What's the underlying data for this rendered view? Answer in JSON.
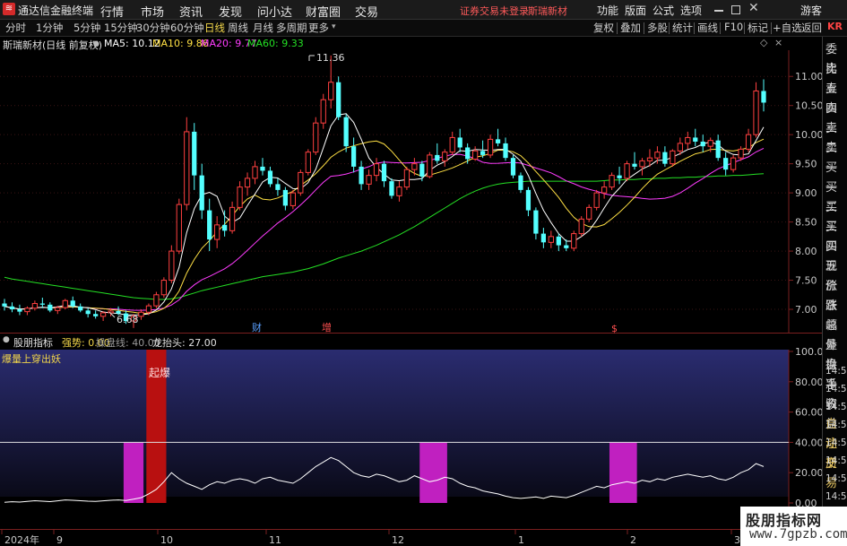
{
  "app": {
    "name": "通达信金融终端",
    "menus": [
      "行情",
      "市场",
      "资讯",
      "发现",
      "问小达",
      "财富圈",
      "交易"
    ],
    "warning": "证券交易未登录",
    "stock_name": "斯瑞新材",
    "right_menus": [
      "功能",
      "版面",
      "公式",
      "选项"
    ],
    "guest": "游客"
  },
  "toolbar": {
    "periods": [
      "分时",
      "1分钟",
      "5分钟",
      "15分钟",
      "30分钟",
      "60分钟",
      "日线",
      "周线",
      "月线",
      "多周期",
      "更多"
    ],
    "active_period": "日线",
    "right_buttons": [
      "复权",
      "叠加",
      "多股",
      "统计",
      "画线",
      "F10",
      "标记",
      "+自选",
      "返回"
    ],
    "kr": "KR"
  },
  "info": {
    "title": "斯瑞新材(日线 前复权)",
    "ma5": "MA5: 10.12",
    "ma10": "MA10: 9.86",
    "ma20": "MA20: 9.77",
    "ma60": "MA60: 9.33"
  },
  "right_panel": [
    "委比",
    "卖五",
    "卖四",
    "卖三",
    "卖二",
    "卖一",
    "买一",
    "买二",
    "买三",
    "买四",
    "买五",
    "现价",
    "涨跌",
    "涨幅",
    "总量",
    "外盘",
    "换手",
    "净资",
    "收益",
    "自动",
    "注册",
    "交易"
  ],
  "price_axis": [
    "11.00",
    "10.50",
    "10.00",
    "9.50",
    "9.00",
    "8.50",
    "8.00",
    "7.50",
    "7.00"
  ],
  "annotations": {
    "high": "11.36",
    "low": "6.68",
    "event1": "财",
    "event2": "增",
    "event3": "$"
  },
  "indicator": {
    "name": "股朋指标",
    "strength": "强势: 0.00",
    "control": "操盘线: 40.00",
    "dragon": "龙抬头: 27.00",
    "signal_text": "爆量上穿出妖",
    "explode_label": "起爆",
    "axis": [
      "100.0",
      "80.00",
      "60.00",
      "40.00",
      "20.00",
      "0.00"
    ],
    "time_axis": [
      "14:56",
      "14:56",
      "14:56",
      "14:56",
      "14:56",
      "14:56",
      "14:56",
      "14:56"
    ]
  },
  "date_axis": [
    "2024年",
    "9",
    "10",
    "11",
    "12",
    "1",
    "2",
    "3"
  ],
  "watermark": {
    "line1": "股朋指标网",
    "line2": "www.7gpzb.com"
  },
  "colors": {
    "up": "#ff4040",
    "down": "#54ffff",
    "ma5": "#ffffff",
    "ma10": "#ffe044",
    "ma20": "#ff3cff",
    "ma60": "#24e024",
    "accent": "#f2d64a"
  },
  "chart_data": {
    "type": "candlestick",
    "title": "斯瑞新材(日线 前复权)",
    "ylim": [
      6.6,
      11.45
    ],
    "candles": [
      [
        7.1,
        7.18,
        6.98,
        7.05
      ],
      [
        7.05,
        7.12,
        6.95,
        7.0
      ],
      [
        7.0,
        7.08,
        6.9,
        6.96
      ],
      [
        6.96,
        7.05,
        6.9,
        7.02
      ],
      [
        7.02,
        7.15,
        6.98,
        7.1
      ],
      [
        7.1,
        7.2,
        7.02,
        7.08
      ],
      [
        7.08,
        7.12,
        6.95,
        6.98
      ],
      [
        6.98,
        7.06,
        6.92,
        7.03
      ],
      [
        7.03,
        7.18,
        7.0,
        7.15
      ],
      [
        7.15,
        7.22,
        7.02,
        7.05
      ],
      [
        7.05,
        7.1,
        6.95,
        6.98
      ],
      [
        6.98,
        7.02,
        6.86,
        6.92
      ],
      [
        6.92,
        6.98,
        6.84,
        6.88
      ],
      [
        6.88,
        6.97,
        6.8,
        6.94
      ],
      [
        6.94,
        7.02,
        6.88,
        6.97
      ],
      [
        6.97,
        7.05,
        6.9,
        6.93
      ],
      [
        6.93,
        6.98,
        6.75,
        6.8
      ],
      [
        6.8,
        6.92,
        6.68,
        6.88
      ],
      [
        6.88,
        7.0,
        6.82,
        6.95
      ],
      [
        6.95,
        7.1,
        6.9,
        7.06
      ],
      [
        7.06,
        7.3,
        7.02,
        7.25
      ],
      [
        7.25,
        7.55,
        7.2,
        7.5
      ],
      [
        7.5,
        8.1,
        7.45,
        8.0
      ],
      [
        8.0,
        8.9,
        7.95,
        8.8
      ],
      [
        8.8,
        10.3,
        8.7,
        10.05
      ],
      [
        10.05,
        10.2,
        9.05,
        9.3
      ],
      [
        9.3,
        9.5,
        8.55,
        8.7
      ],
      [
        8.7,
        8.9,
        8.0,
        8.2
      ],
      [
        8.2,
        8.6,
        8.05,
        8.45
      ],
      [
        8.45,
        8.7,
        8.25,
        8.35
      ],
      [
        8.35,
        8.85,
        8.3,
        8.75
      ],
      [
        8.75,
        9.2,
        8.7,
        9.1
      ],
      [
        9.1,
        9.35,
        8.95,
        9.25
      ],
      [
        9.25,
        9.55,
        9.15,
        9.45
      ],
      [
        9.45,
        9.6,
        9.3,
        9.38
      ],
      [
        9.38,
        9.45,
        9.1,
        9.15
      ],
      [
        9.15,
        9.25,
        8.95,
        9.05
      ],
      [
        9.05,
        9.1,
        8.7,
        8.78
      ],
      [
        8.78,
        9.05,
        8.72,
        9.0
      ],
      [
        9.0,
        9.4,
        8.95,
        9.35
      ],
      [
        9.35,
        9.75,
        9.3,
        9.7
      ],
      [
        9.7,
        10.3,
        9.65,
        10.2
      ],
      [
        10.2,
        10.7,
        10.1,
        10.6
      ],
      [
        10.6,
        11.36,
        10.45,
        10.9
      ],
      [
        10.9,
        11.0,
        10.25,
        10.3
      ],
      [
        10.3,
        10.35,
        9.7,
        9.8
      ],
      [
        9.8,
        9.95,
        9.35,
        9.45
      ],
      [
        9.45,
        9.55,
        9.05,
        9.15
      ],
      [
        9.15,
        9.4,
        9.05,
        9.3
      ],
      [
        9.3,
        9.6,
        9.2,
        9.5
      ],
      [
        9.5,
        9.55,
        9.1,
        9.2
      ],
      [
        9.2,
        9.25,
        8.9,
        8.95
      ],
      [
        8.95,
        9.2,
        8.85,
        9.1
      ],
      [
        9.1,
        9.45,
        9.05,
        9.4
      ],
      [
        9.4,
        9.6,
        9.3,
        9.5
      ],
      [
        9.5,
        9.55,
        9.2,
        9.28
      ],
      [
        9.28,
        9.7,
        9.25,
        9.65
      ],
      [
        9.65,
        9.85,
        9.5,
        9.55
      ],
      [
        9.55,
        9.75,
        9.45,
        9.7
      ],
      [
        9.7,
        10.05,
        9.65,
        9.95
      ],
      [
        9.95,
        10.1,
        9.7,
        9.78
      ],
      [
        9.78,
        9.85,
        9.5,
        9.58
      ],
      [
        9.58,
        9.8,
        9.55,
        9.72
      ],
      [
        9.72,
        9.9,
        9.6,
        9.65
      ],
      [
        9.65,
        10.0,
        9.6,
        9.92
      ],
      [
        9.92,
        10.1,
        9.8,
        9.85
      ],
      [
        9.85,
        9.95,
        9.55,
        9.6
      ],
      [
        9.6,
        9.65,
        9.25,
        9.3
      ],
      [
        9.3,
        9.35,
        9.0,
        9.05
      ],
      [
        9.05,
        9.1,
        8.6,
        8.7
      ],
      [
        8.7,
        8.75,
        8.2,
        8.3
      ],
      [
        8.3,
        8.4,
        8.05,
        8.15
      ],
      [
        8.15,
        8.35,
        8.05,
        8.25
      ],
      [
        8.25,
        8.3,
        8.0,
        8.1
      ],
      [
        8.1,
        8.2,
        8.0,
        8.05
      ],
      [
        8.05,
        8.35,
        8.0,
        8.3
      ],
      [
        8.3,
        8.6,
        8.25,
        8.55
      ],
      [
        8.55,
        8.8,
        8.5,
        8.75
      ],
      [
        8.75,
        9.05,
        8.7,
        9.0
      ],
      [
        9.0,
        9.2,
        8.9,
        9.1
      ],
      [
        9.1,
        9.35,
        9.05,
        9.3
      ],
      [
        9.3,
        9.45,
        9.15,
        9.25
      ],
      [
        9.25,
        9.55,
        9.2,
        9.5
      ],
      [
        9.5,
        9.7,
        9.4,
        9.45
      ],
      [
        9.45,
        9.6,
        9.3,
        9.55
      ],
      [
        9.55,
        9.75,
        9.45,
        9.6
      ],
      [
        9.6,
        9.8,
        9.5,
        9.7
      ],
      [
        9.7,
        9.8,
        9.45,
        9.5
      ],
      [
        9.5,
        9.75,
        9.45,
        9.72
      ],
      [
        9.72,
        9.95,
        9.65,
        9.85
      ],
      [
        9.85,
        10.05,
        9.75,
        9.95
      ],
      [
        9.95,
        10.1,
        9.8,
        9.88
      ],
      [
        9.88,
        10.0,
        9.7,
        9.8
      ],
      [
        9.8,
        9.95,
        9.7,
        9.9
      ],
      [
        9.9,
        10.0,
        9.55,
        9.6
      ],
      [
        9.6,
        9.7,
        9.3,
        9.4
      ],
      [
        9.4,
        9.65,
        9.35,
        9.6
      ],
      [
        9.6,
        9.8,
        9.55,
        9.75
      ],
      [
        9.75,
        10.1,
        9.7,
        10.0
      ],
      [
        10.0,
        10.9,
        9.95,
        10.75
      ],
      [
        10.75,
        10.95,
        10.4,
        10.55
      ]
    ],
    "ma60": [
      7.55,
      7.52,
      7.5,
      7.48,
      7.46,
      7.44,
      7.42,
      7.4,
      7.38,
      7.36,
      7.34,
      7.32,
      7.3,
      7.28,
      7.26,
      7.24,
      7.22,
      7.2,
      7.19,
      7.18,
      7.17,
      7.17,
      7.18,
      7.2,
      7.24,
      7.28,
      7.32,
      7.35,
      7.38,
      7.41,
      7.44,
      7.47,
      7.5,
      7.53,
      7.56,
      7.58,
      7.6,
      7.62,
      7.64,
      7.67,
      7.7,
      7.74,
      7.78,
      7.83,
      7.88,
      7.92,
      7.96,
      8.0,
      8.05,
      8.1,
      8.16,
      8.22,
      8.28,
      8.35,
      8.42,
      8.5,
      8.58,
      8.66,
      8.74,
      8.82,
      8.9,
      8.97,
      9.03,
      9.08,
      9.12,
      9.15,
      9.17,
      9.18,
      9.19,
      9.2,
      9.2,
      9.2,
      9.2,
      9.2,
      9.2,
      9.2,
      9.2,
      9.2,
      9.2,
      9.21,
      9.22,
      9.22,
      9.23,
      9.23,
      9.24,
      9.24,
      9.25,
      9.25,
      9.26,
      9.26,
      9.27,
      9.27,
      9.28,
      9.28,
      9.29,
      9.29,
      9.3,
      9.3,
      9.31,
      9.32,
      9.33
    ],
    "strength_line": [
      0.5,
      0.8,
      0.6,
      1.0,
      1.5,
      1.2,
      0.9,
      1.4,
      2.0,
      1.8,
      1.5,
      1.2,
      1.0,
      1.4,
      1.8,
      2.0,
      1.6,
      2.5,
      3.5,
      6.0,
      9.0,
      14.0,
      20.0,
      16.0,
      13.0,
      11.0,
      9.0,
      12.0,
      14.0,
      13.0,
      15.0,
      16.0,
      15.0,
      13.0,
      16.0,
      17.0,
      15.0,
      14.0,
      13.0,
      16.0,
      20.0,
      24.0,
      27.0,
      30.0,
      28.0,
      24.0,
      20.0,
      18.0,
      17.0,
      19.0,
      18.0,
      16.0,
      14.0,
      15.0,
      18.0,
      16.0,
      14.0,
      15.0,
      17.0,
      16.0,
      13.0,
      11.0,
      10.0,
      8.0,
      7.0,
      6.0,
      4.5,
      3.5,
      3.0,
      3.5,
      4.0,
      3.0,
      4.5,
      4.0,
      3.5,
      5.0,
      7.0,
      9.0,
      11.0,
      10.0,
      12.0,
      13.0,
      14.0,
      13.0,
      15.0,
      14.0,
      16.0,
      15.0,
      17.0,
      18.0,
      19.0,
      18.0,
      17.0,
      18.0,
      16.0,
      15.0,
      17.0,
      20.0,
      22.0,
      26.0,
      24.0
    ],
    "pink_bars": [
      {
        "from": 16,
        "to": 18,
        "value": 40
      },
      {
        "from": 55,
        "to": 58,
        "value": 40
      },
      {
        "from": 80,
        "to": 83,
        "value": 40
      }
    ],
    "red_bar": {
      "from": 19,
      "to": 21,
      "value": 100
    },
    "control_line": 40
  }
}
